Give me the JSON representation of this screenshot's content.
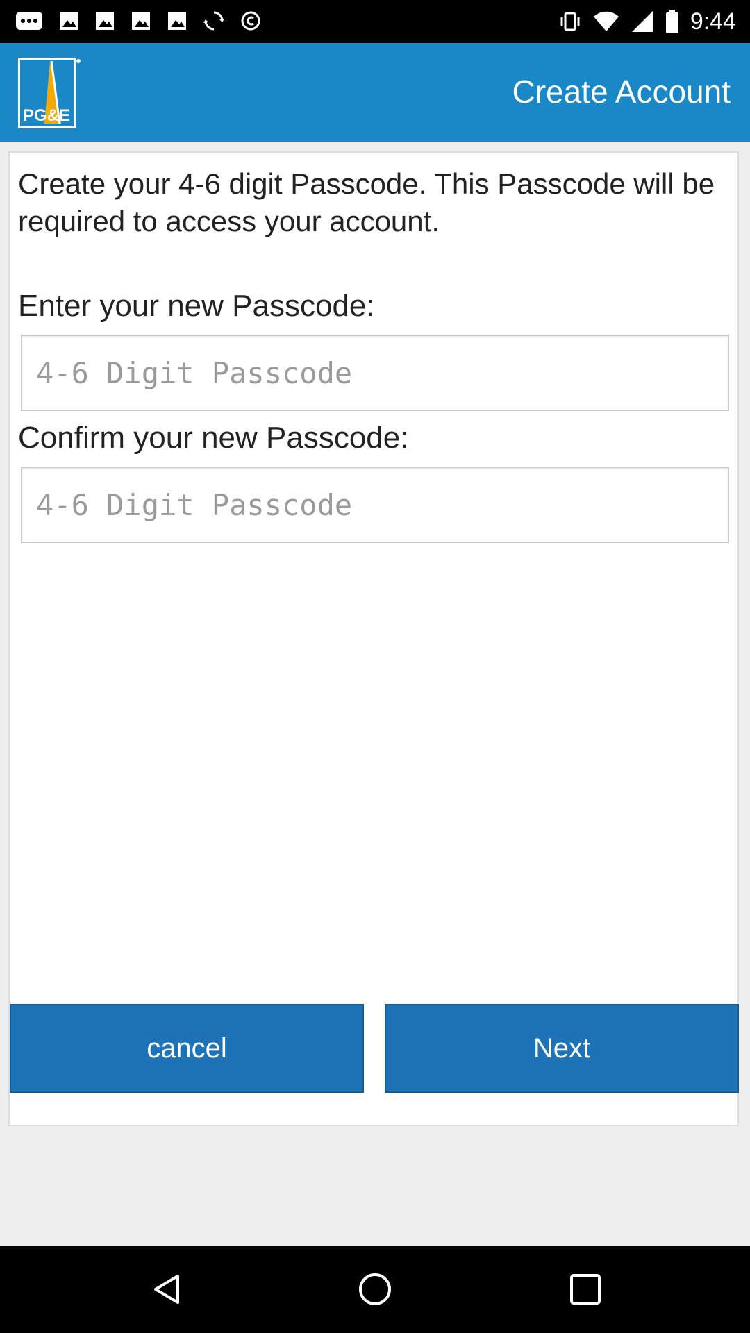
{
  "status_bar": {
    "time": "9:44",
    "left_icons": [
      "more-icon",
      "image-icon",
      "image-icon",
      "image-icon",
      "image-icon",
      "sync-icon",
      "copyright-icon"
    ],
    "right_icons": [
      "vibrate-icon",
      "wifi-icon",
      "signal-icon",
      "battery-icon"
    ]
  },
  "app_bar": {
    "logo_text": "PG&E",
    "title": "Create Account",
    "color": "#1a87c6"
  },
  "form": {
    "intro": "Create your 4-6 digit Passcode. This Passcode will be required to access your account.",
    "new_label": "Enter your new Passcode:",
    "new_placeholder": "4-6 Digit Passcode",
    "new_value": "",
    "confirm_label": "Confirm your new Passcode:",
    "confirm_placeholder": "4-6 Digit Passcode",
    "confirm_value": ""
  },
  "buttons": {
    "cancel": "cancel",
    "next": "Next",
    "color": "#1d73b5"
  },
  "nav_bar": {
    "icons": [
      "back-icon",
      "home-icon",
      "recents-icon"
    ]
  }
}
